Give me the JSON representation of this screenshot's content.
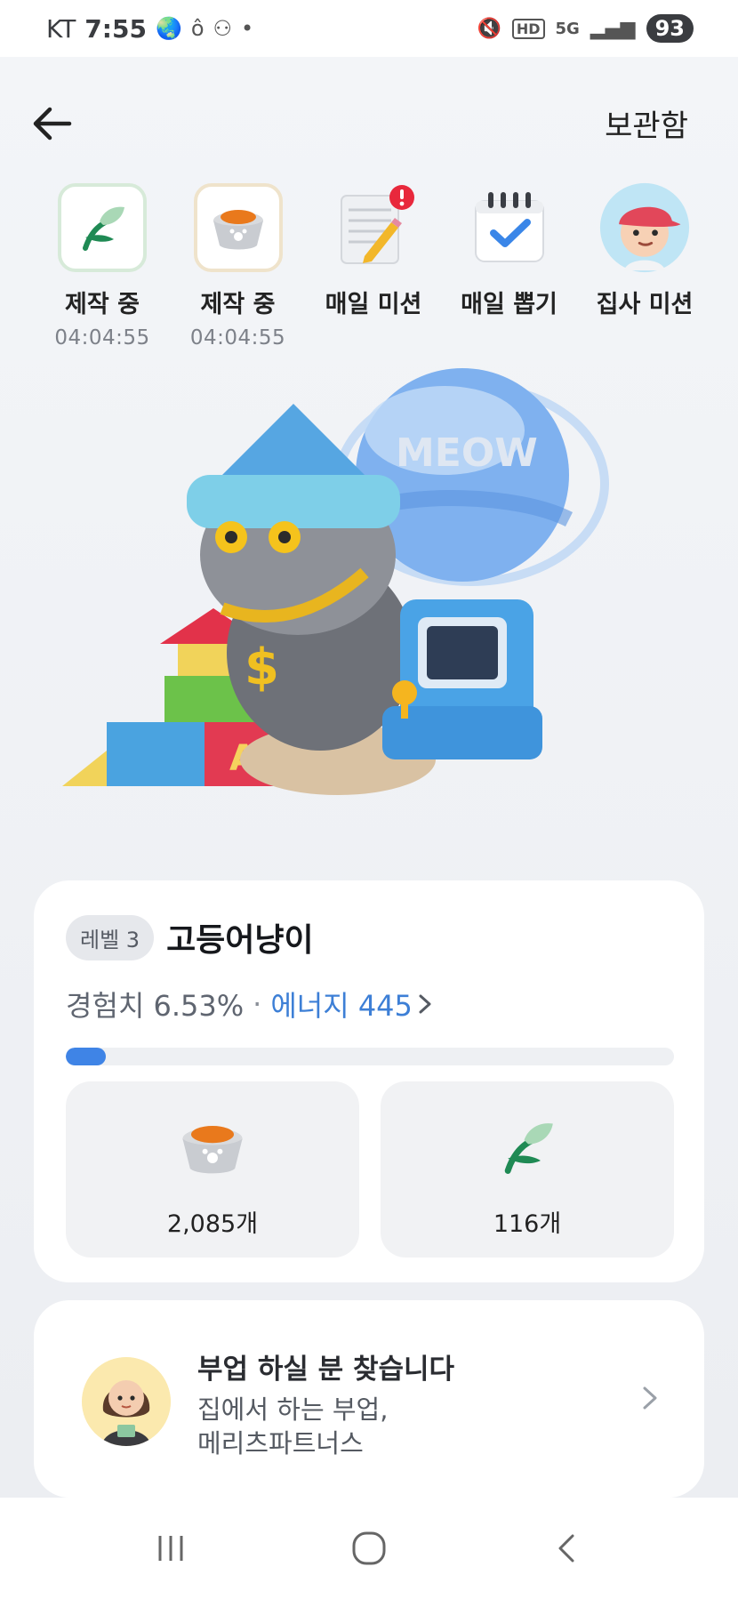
{
  "status_bar": {
    "carrier": "KT",
    "time": "7:55",
    "network": "5G",
    "hd": "HD",
    "battery": "93"
  },
  "header": {
    "storage_label": "보관함"
  },
  "quick_actions": [
    {
      "label": "제작 중",
      "time": "04:04:55",
      "icon": "leaf-icon"
    },
    {
      "label": "제작 중",
      "time": "04:04:55",
      "icon": "food-bowl-icon"
    },
    {
      "label": "매일 미션",
      "icon": "notepad-icon"
    },
    {
      "label": "매일 뽑기",
      "icon": "calendar-check-icon"
    },
    {
      "label": "집사 미션",
      "icon": "boy-avatar-icon"
    }
  ],
  "hero": {
    "planet_text": "MEOW"
  },
  "level": {
    "level_label": "레벨 3",
    "name": "고등어냥이",
    "exp_text": "경험치 6.53%",
    "separator": "·",
    "energy_text": "에너지 445",
    "progress_fraction": 0.0653
  },
  "resources": [
    {
      "icon": "food-bowl-icon",
      "count": "2,085개"
    },
    {
      "icon": "leaf-icon",
      "count": "116개"
    }
  ],
  "ad": {
    "title": "부업 하실 분 찾습니다",
    "line1": "집에서 하는 부업,",
    "line2": "메리츠파트너스"
  },
  "colors": {
    "accent": "#3d7fd6",
    "progress": "#3f84e6",
    "card": "#ffffff",
    "background": "#eef0f3"
  }
}
